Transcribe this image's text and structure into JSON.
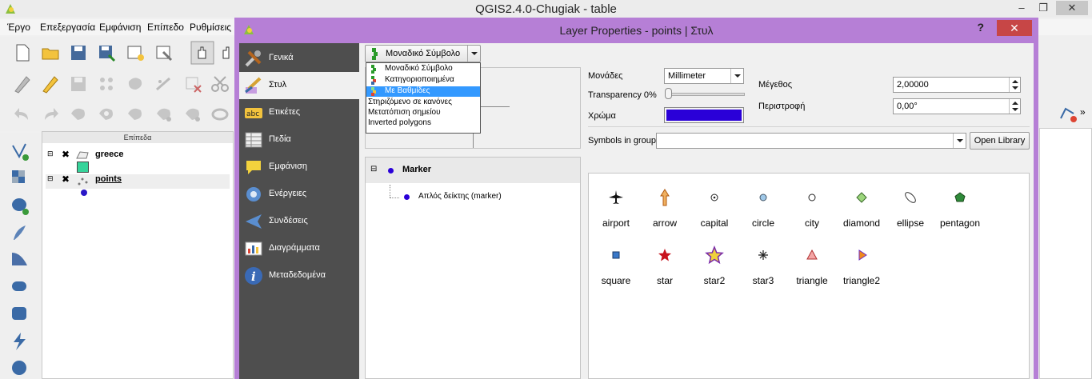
{
  "app": {
    "title": "QGIS2.4.0-Chugiak - table",
    "menu": [
      "Έργο",
      "Επεξεργασία",
      "Εμφάνιση",
      "Επίπεδο",
      "Ρυθμίσεις"
    ],
    "window_buttons": [
      "–",
      "❐",
      "✕"
    ]
  },
  "layers_panel": {
    "header": "Επίπεδα",
    "layers": [
      {
        "name": "greece",
        "checked": true,
        "color": "#36d39a"
      },
      {
        "name": "points",
        "checked": true,
        "color": "#2a17c7"
      }
    ]
  },
  "dialog": {
    "title": "Layer Properties - points | Στυλ",
    "help": "?",
    "close": "✕",
    "sidebar": [
      {
        "label": "Γενικά",
        "icon": "tools-icon"
      },
      {
        "label": "Στυλ",
        "icon": "paint-icon",
        "selected": true
      },
      {
        "label": "Ετικέτες",
        "icon": "labels-icon"
      },
      {
        "label": "Πεδία",
        "icon": "fields-icon"
      },
      {
        "label": "Εμφάνιση",
        "icon": "display-icon"
      },
      {
        "label": "Ενέργειες",
        "icon": "actions-icon"
      },
      {
        "label": "Συνδέσεις",
        "icon": "joins-icon"
      },
      {
        "label": "Διαγράμματα",
        "icon": "diagrams-icon"
      },
      {
        "label": "Μεταδεδομένα",
        "icon": "metadata-icon"
      }
    ],
    "renderer_combo": "Μοναδικό Σύμβολο",
    "renderer_options": [
      "Μοναδικό Σύμβολο",
      "Κατηγοριοποιημένα",
      "Με Βαθμίδες",
      "Στηριζόμενο σε κανόνες",
      "Μετατόπιση σημείου",
      "Inverted polygons"
    ],
    "renderer_highlighted_index": 2,
    "tree": {
      "root": "Marker",
      "child": "Απλός δείκτης (marker)"
    },
    "form": {
      "units_label": "Μονάδες",
      "units_value": "Millimeter",
      "transparency_label": "Transparency 0%",
      "transparency_value": 0,
      "color_label": "Χρώμα",
      "color_value": "#2a00d8",
      "size_label": "Μέγεθος",
      "size_value": "2,00000",
      "rotation_label": "Περιστροφή",
      "rotation_value": "0,00°",
      "symbols_group_label": "Symbols in group",
      "symbols_group_value": "",
      "open_library": "Open Library"
    },
    "symbols": [
      {
        "name": "airport",
        "icon": "airplane-icon"
      },
      {
        "name": "arrow",
        "icon": "arrow-up-icon"
      },
      {
        "name": "capital",
        "icon": "capital-icon"
      },
      {
        "name": "circle",
        "icon": "circle-icon"
      },
      {
        "name": "city",
        "icon": "city-icon"
      },
      {
        "name": "diamond",
        "icon": "diamond-icon"
      },
      {
        "name": "ellipse",
        "icon": "ellipse-icon"
      },
      {
        "name": "pentagon",
        "icon": "pentagon-icon"
      },
      {
        "name": "square",
        "icon": "square-icon"
      },
      {
        "name": "star",
        "icon": "star-icon"
      },
      {
        "name": "star2",
        "icon": "star2-icon"
      },
      {
        "name": "star3",
        "icon": "star3-icon"
      },
      {
        "name": "triangle",
        "icon": "triangle-icon"
      },
      {
        "name": "triangle2",
        "icon": "triangle2-icon"
      }
    ]
  }
}
